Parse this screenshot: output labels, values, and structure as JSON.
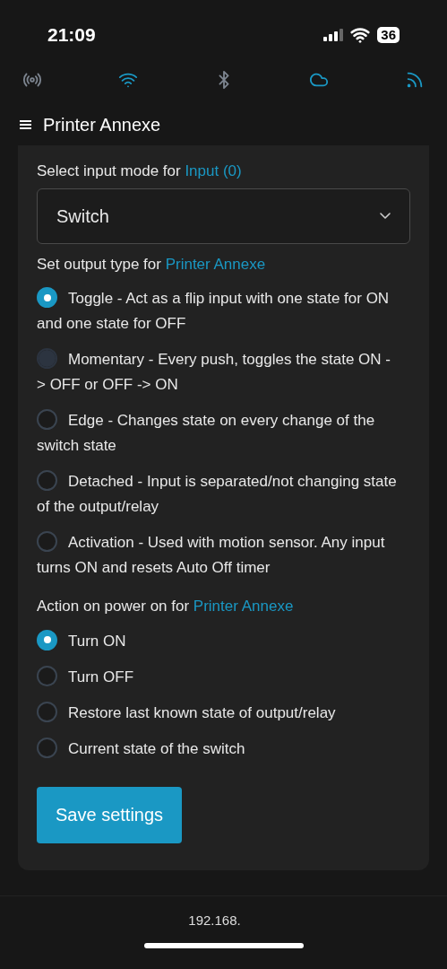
{
  "status_bar": {
    "time": "21:09",
    "battery": "36"
  },
  "nav_icons": [
    {
      "kind": "broadcast",
      "selected": false
    },
    {
      "kind": "wifi",
      "selected": true
    },
    {
      "kind": "bluetooth",
      "selected": false
    },
    {
      "kind": "cloud",
      "selected": true
    },
    {
      "kind": "feed",
      "selected": true
    }
  ],
  "header": {
    "title": "Printer Annexe"
  },
  "input_mode": {
    "label": "Select input mode for ",
    "link": "Input (0)",
    "value": "Switch"
  },
  "output_type": {
    "label": "Set output type for ",
    "link": "Printer Annexe",
    "options": [
      {
        "text": "Toggle - Act as a flip input with one state for ON and one state for OFF",
        "selected": true,
        "focused": false
      },
      {
        "text": "Momentary - Every push, toggles the state ON -> OFF or OFF -> ON",
        "selected": false,
        "focused": true
      },
      {
        "text": "Edge - Changes state on every change of the switch state",
        "selected": false,
        "focused": false
      },
      {
        "text": "Detached - Input is separated/not changing state of the output/relay",
        "selected": false,
        "focused": false
      },
      {
        "text": "Activation - Used with motion sensor. Any input turns ON and resets Auto Off timer",
        "selected": false,
        "focused": false
      }
    ]
  },
  "power_on": {
    "label": "Action on power on for ",
    "link": "Printer Annexe",
    "options": [
      {
        "text": "Turn ON",
        "selected": true
      },
      {
        "text": "Turn OFF",
        "selected": false
      },
      {
        "text": "Restore last known state of output/relay",
        "selected": false
      },
      {
        "text": "Current state of the switch",
        "selected": false
      }
    ]
  },
  "save_button": "Save settings",
  "footer": {
    "address": "192.168."
  }
}
